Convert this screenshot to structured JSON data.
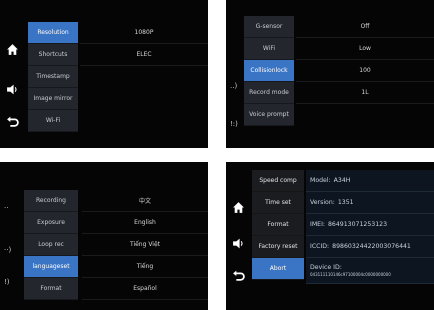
{
  "panel1": {
    "menu": [
      "Resolution",
      "Shortcuts",
      "Timestamp",
      "Image mirror",
      "Wi-Fi"
    ],
    "selected_index": 0,
    "values": [
      "1080P",
      "ELEC"
    ]
  },
  "panel2": {
    "menu": [
      "G-sensor",
      "WiFi",
      "Collisionlock",
      "Record mode",
      "Voice prompt"
    ],
    "selected_index": 2,
    "values": [
      "Off",
      "Low",
      "100",
      "1L"
    ],
    "side_labels": [
      "..)",
      "!:)"
    ]
  },
  "panel3": {
    "menu": [
      "Recording",
      "Exposure",
      "Loop rec",
      "languageset",
      "Format"
    ],
    "selected_index": 3,
    "values": [
      "中文",
      "English",
      "Tiếng Việt",
      "Tiếng",
      "Español"
    ],
    "side_labels": [
      "··",
      "··)",
      "!)"
    ]
  },
  "panel4": {
    "menu": [
      "Speed comp",
      "Time set",
      "Format",
      "Factory reset",
      "Abort"
    ],
    "selected_index": 4,
    "info": {
      "model_label": "Model:",
      "model_value": "A34H",
      "version_label": "Version:",
      "version_value": "1351",
      "imei_label": "IMEI:",
      "imei_value": "864913071253123",
      "iccid_label": "ICCID:",
      "iccid_value": "89860324422003076441",
      "device_label": "Device ID:",
      "device_value": "043111110146c97100004c0000000000"
    }
  }
}
